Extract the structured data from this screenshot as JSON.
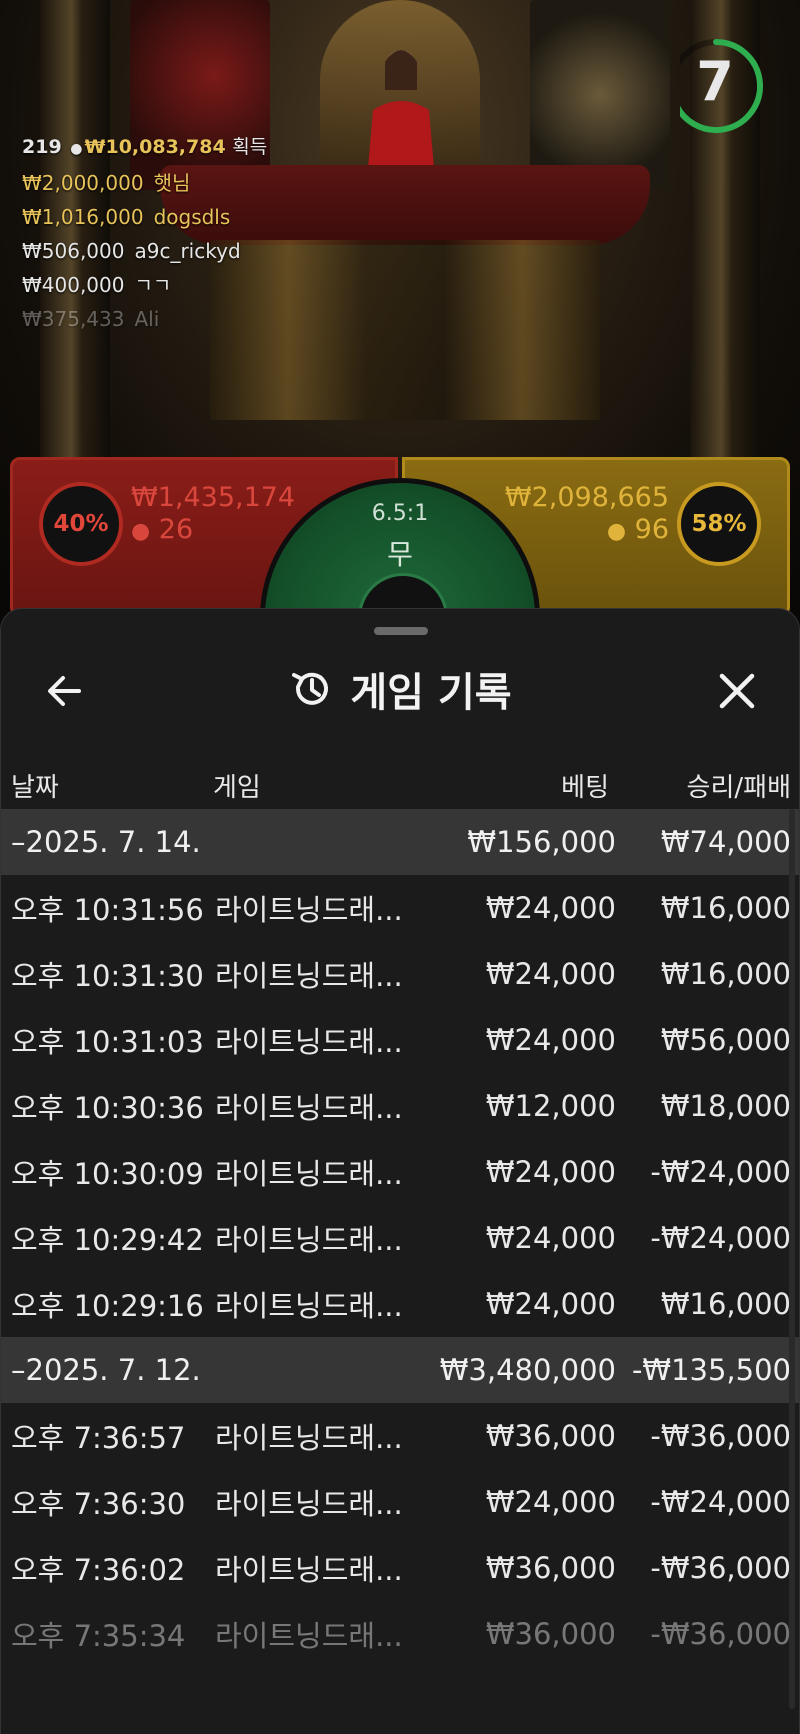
{
  "timer": {
    "seconds": "7",
    "progress_fraction": 0.7
  },
  "player_board": {
    "player_count": "219",
    "total_won": "₩10,083,784",
    "won_label": "획득",
    "winners": [
      {
        "amount": "₩2,000,000",
        "name": "햇님",
        "tone": "gold"
      },
      {
        "amount": "₩1,016,000",
        "name": "dogsdls",
        "tone": "gold"
      },
      {
        "amount": "₩506,000",
        "name": "a9c_rickyd",
        "tone": "white"
      },
      {
        "amount": "₩400,000",
        "name": "ㄱㄱ",
        "tone": "white"
      },
      {
        "amount": "₩375,433",
        "name": "Ali",
        "tone": "fade"
      }
    ]
  },
  "betting": {
    "dragon": {
      "percent": "40%",
      "amount": "₩1,435,174",
      "players": "26",
      "color": "#8a1d18"
    },
    "tiger": {
      "percent": "58%",
      "amount": "₩2,098,665",
      "players": "96",
      "color": "#8a6c12"
    },
    "tie": {
      "odds": "6.5:1",
      "label": "무"
    }
  },
  "sheet": {
    "title": "게임 기록",
    "columns": {
      "date": "날짜",
      "game": "게임",
      "bet": "베팅",
      "result": "승리/패배"
    },
    "groups": [
      {
        "date": "–2025. 7. 14.",
        "total_bet": "₩156,000",
        "total_result": "₩74,000",
        "rows": [
          {
            "time": "오후 10:31:56",
            "game": "라이트닝드래...",
            "bet": "₩24,000",
            "result": "₩16,000"
          },
          {
            "time": "오후 10:31:30",
            "game": "라이트닝드래...",
            "bet": "₩24,000",
            "result": "₩16,000"
          },
          {
            "time": "오후 10:31:03",
            "game": "라이트닝드래...",
            "bet": "₩24,000",
            "result": "₩56,000"
          },
          {
            "time": "오후 10:30:36",
            "game": "라이트닝드래...",
            "bet": "₩12,000",
            "result": "₩18,000"
          },
          {
            "time": "오후 10:30:09",
            "game": "라이트닝드래...",
            "bet": "₩24,000",
            "result": "-₩24,000"
          },
          {
            "time": "오후 10:29:42",
            "game": "라이트닝드래...",
            "bet": "₩24,000",
            "result": "-₩24,000"
          },
          {
            "time": "오후 10:29:16",
            "game": "라이트닝드래...",
            "bet": "₩24,000",
            "result": "₩16,000"
          }
        ]
      },
      {
        "date": "–2025. 7. 12.",
        "total_bet": "₩3,480,000",
        "total_result": "-₩135,500",
        "rows": [
          {
            "time": "오후 7:36:57",
            "game": "라이트닝드래...",
            "bet": "₩36,000",
            "result": "-₩36,000"
          },
          {
            "time": "오후 7:36:30",
            "game": "라이트닝드래...",
            "bet": "₩24,000",
            "result": "-₩24,000"
          },
          {
            "time": "오후 7:36:02",
            "game": "라이트닝드래...",
            "bet": "₩36,000",
            "result": "-₩36,000"
          },
          {
            "time": "오후 7:35:34",
            "game": "라이트닝드래...",
            "bet": "₩36,000",
            "result": "-₩36,000"
          }
        ]
      }
    ]
  }
}
